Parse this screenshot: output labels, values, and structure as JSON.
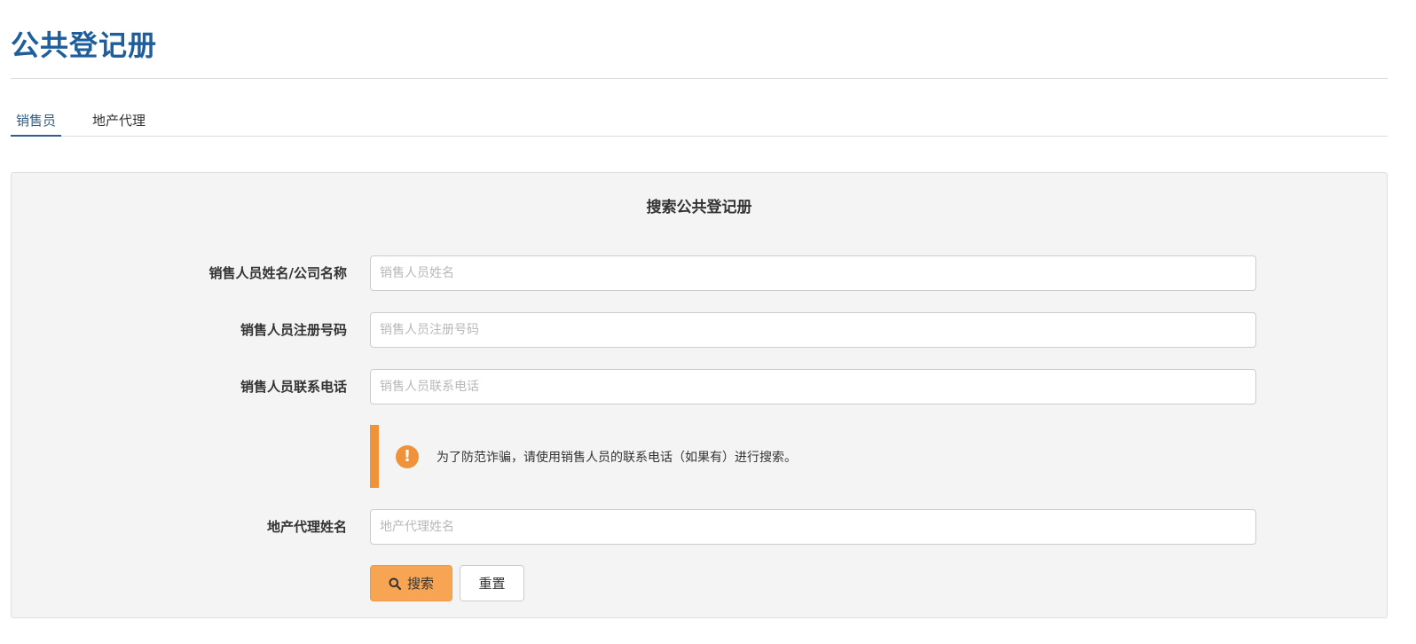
{
  "header": {
    "title": "公共登记册"
  },
  "tabs": [
    {
      "label": "销售员",
      "active": true
    },
    {
      "label": "地产代理",
      "active": false
    }
  ],
  "panel": {
    "heading": "搜索公共登记册",
    "fields": [
      {
        "label": "销售人员姓名/公司名称",
        "placeholder": "销售人员姓名",
        "value": ""
      },
      {
        "label": "销售人员注册号码",
        "placeholder": "销售人员注册号码",
        "value": ""
      },
      {
        "label": "销售人员联系电话",
        "placeholder": "销售人员联系电话",
        "value": ""
      },
      {
        "label": "地产代理姓名",
        "placeholder": "地产代理姓名",
        "value": ""
      }
    ],
    "notice": {
      "icon": "exclamation-circle-icon",
      "symbol": "!",
      "text": "为了防范诈骗，请使用销售人员的联系电话（如果有）进行搜索。"
    },
    "buttons": {
      "search_label": "搜索",
      "search_icon": "search-icon",
      "reset_label": "重置"
    }
  },
  "colors": {
    "title": "#1f5e9c",
    "active_tab": "#2f5f8a",
    "accent_orange": "#f0923a",
    "search_button": "#f8a553",
    "panel_bg": "#f4f4f4"
  }
}
